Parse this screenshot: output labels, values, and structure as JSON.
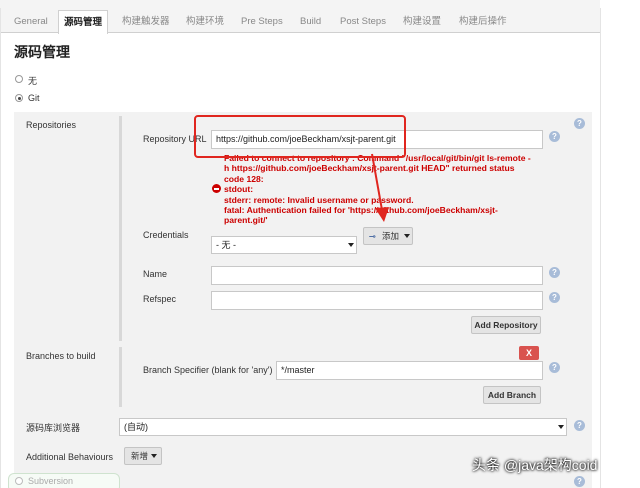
{
  "tabs": [
    "General",
    "源码管理",
    "构建触发器",
    "构建环境",
    "Pre Steps",
    "Build",
    "Post Steps",
    "构建设置",
    "构建后操作"
  ],
  "section_title": "源码管理",
  "scm_options": {
    "none": "无",
    "git": "Git",
    "selected": "Git"
  },
  "repositories": {
    "label": "Repositories",
    "url_label": "Repository URL",
    "url_value": "https://github.com/joeBeckham/xsjt-parent.git",
    "error_lines": [
      "Failed to connect to repository : Command \"/usr/local/git/bin/git ls-remote -",
      "h https://github.com/joeBeckham/xsjt-parent.git HEAD\" returned status",
      "code 128:",
      "stdout:",
      "stderr: remote: Invalid username or password.",
      "fatal: Authentication failed for 'https://github.com/joeBeckham/xsjt-",
      "parent.git/'"
    ],
    "credentials_label": "Credentials",
    "credentials_value": "- 无 -",
    "add_button": "添加",
    "name_label": "Name",
    "refspec_label": "Refspec",
    "add_repository_button": "Add Repository"
  },
  "branches": {
    "label": "Branches to build",
    "delete_button": "X",
    "specifier_label": "Branch Specifier (blank for 'any')",
    "specifier_value": "*/master",
    "add_branch_button": "Add Branch"
  },
  "browser": {
    "label": "源码库浏览器",
    "value": "(自动)"
  },
  "behaviours": {
    "label": "Additional Behaviours",
    "add_button": "新增"
  },
  "subversion_label": "Subversion",
  "watermark": "头条 @java架构coid",
  "colors": {
    "accent_red": "#e0261f",
    "error_red": "#cc0000",
    "help_blue": "#3b6fb0"
  }
}
